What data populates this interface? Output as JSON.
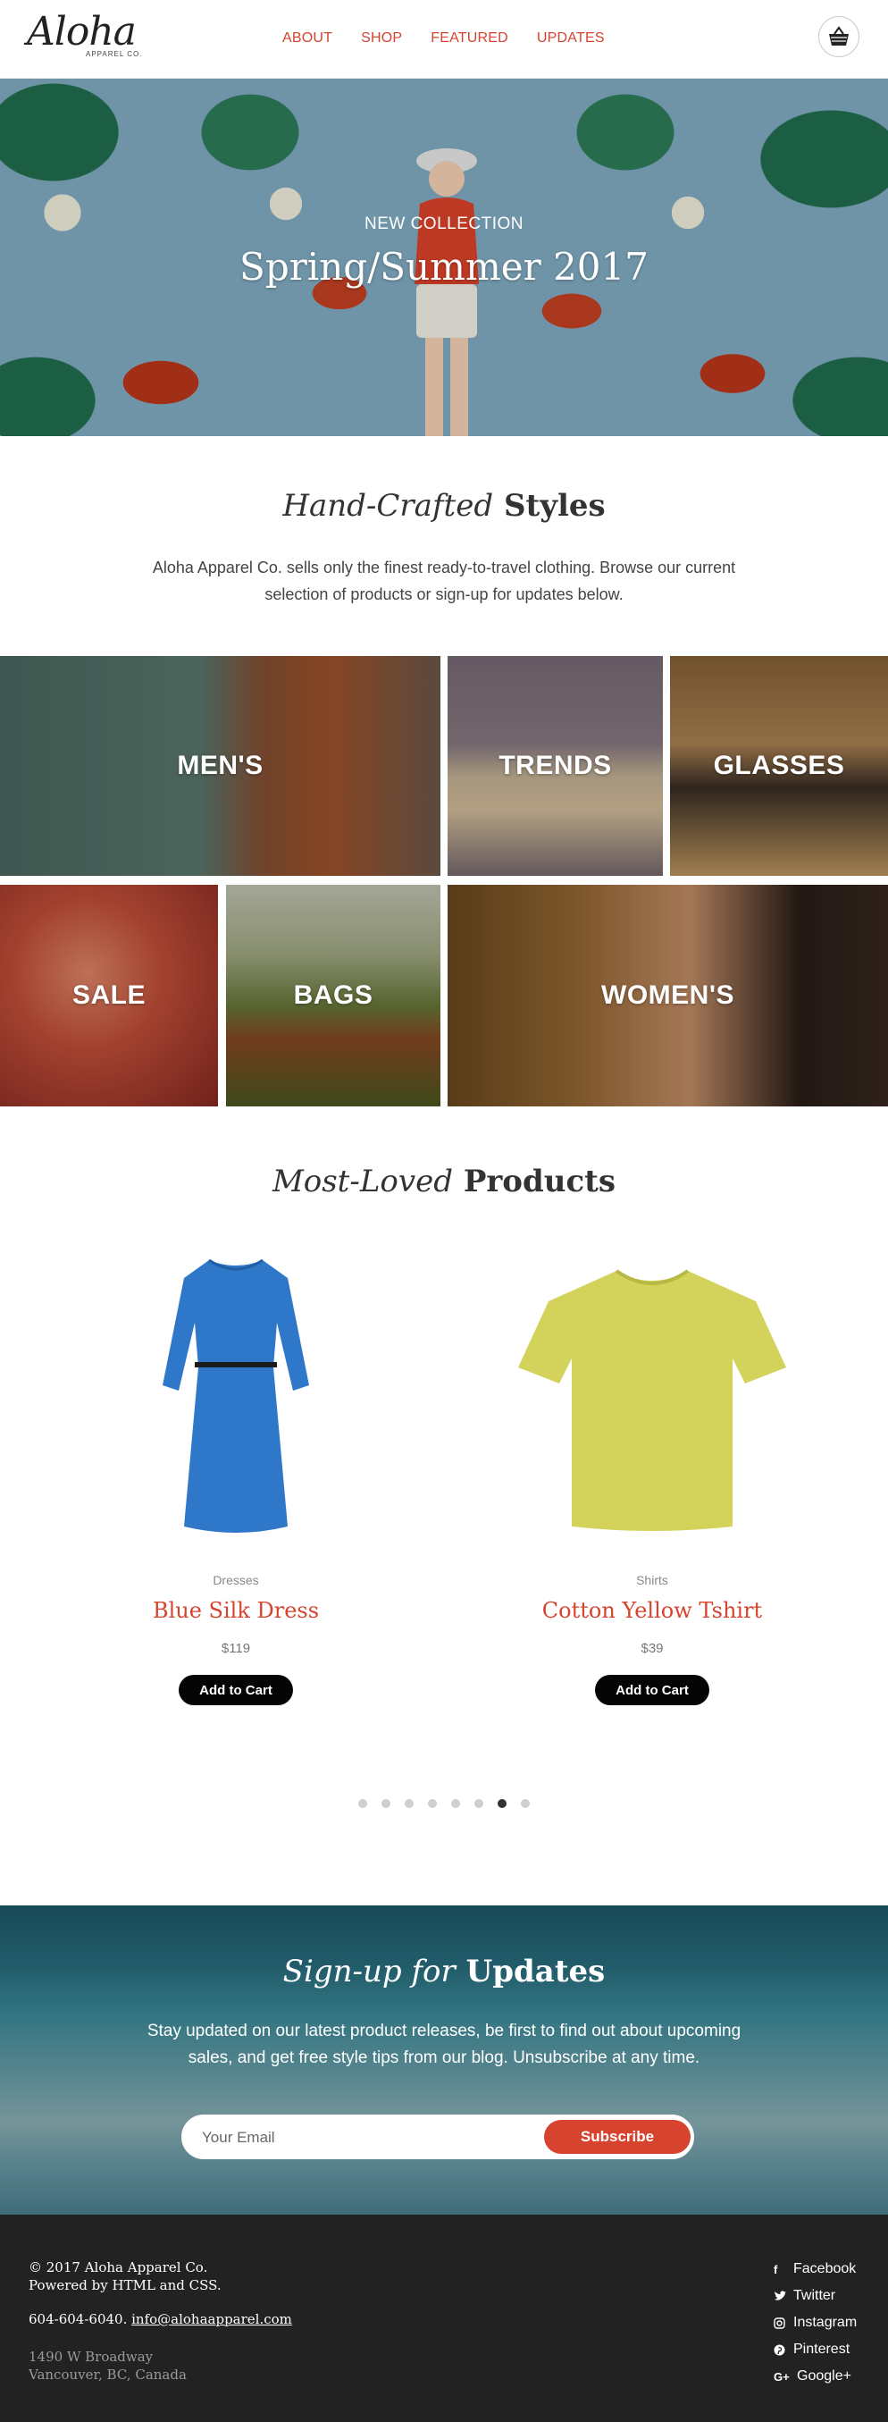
{
  "brand": {
    "logo_main": "Aloha",
    "logo_sub": "APPAREL CO."
  },
  "nav": {
    "items": [
      "ABOUT",
      "SHOP",
      "FEATURED",
      "UPDATES"
    ]
  },
  "hero": {
    "kicker": "NEW COLLECTION",
    "title": "Spring/Summer 2017"
  },
  "intro": {
    "title_italic": "Hand-Crafted",
    "title_bold": "Styles",
    "text": "Aloha Apparel Co. sells only the finest ready-to-travel clothing. Browse our current selection of products or sign-up for updates below."
  },
  "categories": [
    "MEN'S",
    "TRENDS",
    "GLASSES",
    "SALE",
    "BAGS",
    "WOMEN'S"
  ],
  "products": {
    "title_italic": "Most-Loved",
    "title_bold": "Products",
    "items": [
      {
        "category": "Dresses",
        "name": "Blue Silk Dress",
        "price": "$119",
        "cta": "Add to Cart"
      },
      {
        "category": "Shirts",
        "name": "Cotton Yellow Tshirt",
        "price": "$39",
        "cta": "Add to Cart"
      }
    ],
    "carousel_pages": 8,
    "carousel_active": 7
  },
  "signup": {
    "title_italic": "Sign-up for",
    "title_bold": "Updates",
    "text": "Stay updated on our latest product releases, be first to find out about upcoming sales, and get free style tips from our blog. Unsubscribe at any time.",
    "email_placeholder": "Your Email",
    "button": "Subscribe"
  },
  "footer": {
    "copyright": "© 2017 Aloha Apparel Co.",
    "powered": "Powered by HTML and CSS.",
    "phone": "604-604-6040.",
    "email": "info@alohaapparel.com",
    "address_line1": "1490 W Broadway",
    "address_line2": "Vancouver, BC, Canada",
    "social": [
      "Facebook",
      "Twitter",
      "Instagram",
      "Pinterest",
      "Google+"
    ]
  },
  "colors": {
    "accent": "#d6432e",
    "footer_bg": "#222222",
    "button_dark": "#050505"
  }
}
